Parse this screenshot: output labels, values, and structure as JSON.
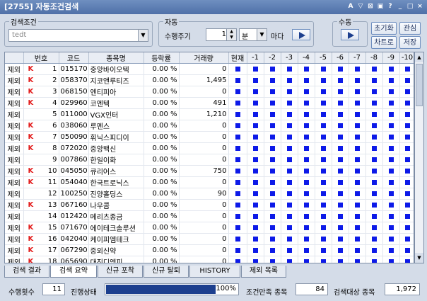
{
  "window": {
    "title": "[2755] 자동조건검색",
    "controls": [
      "A",
      "▽",
      "⊠",
      "▣",
      "?",
      "_",
      "□",
      "×"
    ]
  },
  "search_group": {
    "label": "검색조건",
    "combo_value": "tedt"
  },
  "auto_group": {
    "label": "자동",
    "interval_label": "수행주기",
    "interval_value": "1",
    "unit_value": "분",
    "suffix": "마다"
  },
  "manual_group": {
    "label": "수동"
  },
  "buttons": {
    "reset": "초기화",
    "interest": "관심",
    "chart": "차트로",
    "save": "저장"
  },
  "grid": {
    "headers": [
      "",
      "번호",
      "코드",
      "종목명",
      "등락률",
      "거래량",
      "현재",
      "-1",
      "-2",
      "-3",
      "-4",
      "-5",
      "-6",
      "-7",
      "-8",
      "-9",
      "-10"
    ],
    "rows": [
      {
        "action": "제외",
        "k": "K",
        "no": "1",
        "code": "015170",
        "name": "중앙바이오텍",
        "rate": "0.00 %",
        "vol": "0"
      },
      {
        "action": "제외",
        "k": "K",
        "no": "2",
        "code": "058370",
        "name": "지코앤루티즈",
        "rate": "0.00 %",
        "vol": "1,495"
      },
      {
        "action": "제외",
        "k": "K",
        "no": "3",
        "code": "068150",
        "name": "엔티피아",
        "rate": "0.00 %",
        "vol": "0"
      },
      {
        "action": "제외",
        "k": "K",
        "no": "4",
        "code": "029960",
        "name": "코엔텍",
        "rate": "0.00 %",
        "vol": "491"
      },
      {
        "action": "제외",
        "k": "",
        "no": "5",
        "code": "011000",
        "name": "VGX인터",
        "rate": "0.00 %",
        "vol": "1,210"
      },
      {
        "action": "제외",
        "k": "K",
        "no": "6",
        "code": "038060",
        "name": "루멘스",
        "rate": "0.00 %",
        "vol": "0"
      },
      {
        "action": "제외",
        "k": "K",
        "no": "7",
        "code": "050090",
        "name": "휘닉스피디이",
        "rate": "0.00 %",
        "vol": "0"
      },
      {
        "action": "제외",
        "k": "K",
        "no": "8",
        "code": "072020",
        "name": "중앙백신",
        "rate": "0.00 %",
        "vol": "0"
      },
      {
        "action": "제외",
        "k": "",
        "no": "9",
        "code": "007860",
        "name": "한일이화",
        "rate": "0.00 %",
        "vol": "0"
      },
      {
        "action": "제외",
        "k": "K",
        "no": "10",
        "code": "045050",
        "name": "큐리어스",
        "rate": "0.00 %",
        "vol": "750"
      },
      {
        "action": "제외",
        "k": "K",
        "no": "11",
        "code": "054040",
        "name": "한국트로닉스",
        "rate": "0.00 %",
        "vol": "0"
      },
      {
        "action": "제외",
        "k": "",
        "no": "12",
        "code": "100250",
        "name": "진양홀딩스",
        "rate": "0.00 %",
        "vol": "90"
      },
      {
        "action": "제외",
        "k": "K",
        "no": "13",
        "code": "067160",
        "name": "나우콤",
        "rate": "0.00 %",
        "vol": "0"
      },
      {
        "action": "제외",
        "k": "",
        "no": "14",
        "code": "012420",
        "name": "메리츠종금",
        "rate": "0.00 %",
        "vol": "0"
      },
      {
        "action": "제외",
        "k": "K",
        "no": "15",
        "code": "071670",
        "name": "에이테크솔루션",
        "rate": "0.00 %",
        "vol": "0"
      },
      {
        "action": "제외",
        "k": "K",
        "no": "16",
        "code": "042040",
        "name": "케이피엠테크",
        "rate": "0.00 %",
        "vol": "0"
      },
      {
        "action": "제외",
        "k": "K",
        "no": "17",
        "code": "067290",
        "name": "중외신약",
        "rate": "0.00 %",
        "vol": "0"
      },
      {
        "action": "제외",
        "k": "K",
        "no": "18",
        "code": "065690",
        "name": "대진디엠피",
        "rate": "0.00 %",
        "vol": "0"
      }
    ]
  },
  "tabs": [
    "검색 결과",
    "검색 요약",
    "신규 포착",
    "신규 탈퇴",
    "HISTORY",
    "제외 목록"
  ],
  "status": {
    "count_label": "수행횟수",
    "count_value": "11",
    "progress_label": "진행상태",
    "progress_value": "100%",
    "match_label": "조건만족 종목",
    "match_value": "84",
    "target_label": "검색대상 종목",
    "target_value": "1,972"
  },
  "colors": {
    "title_bar": "#5a7ab2",
    "signal": "#0d1ae8",
    "k_mark": "#e21a1a",
    "progress": "#1c3f8e"
  }
}
